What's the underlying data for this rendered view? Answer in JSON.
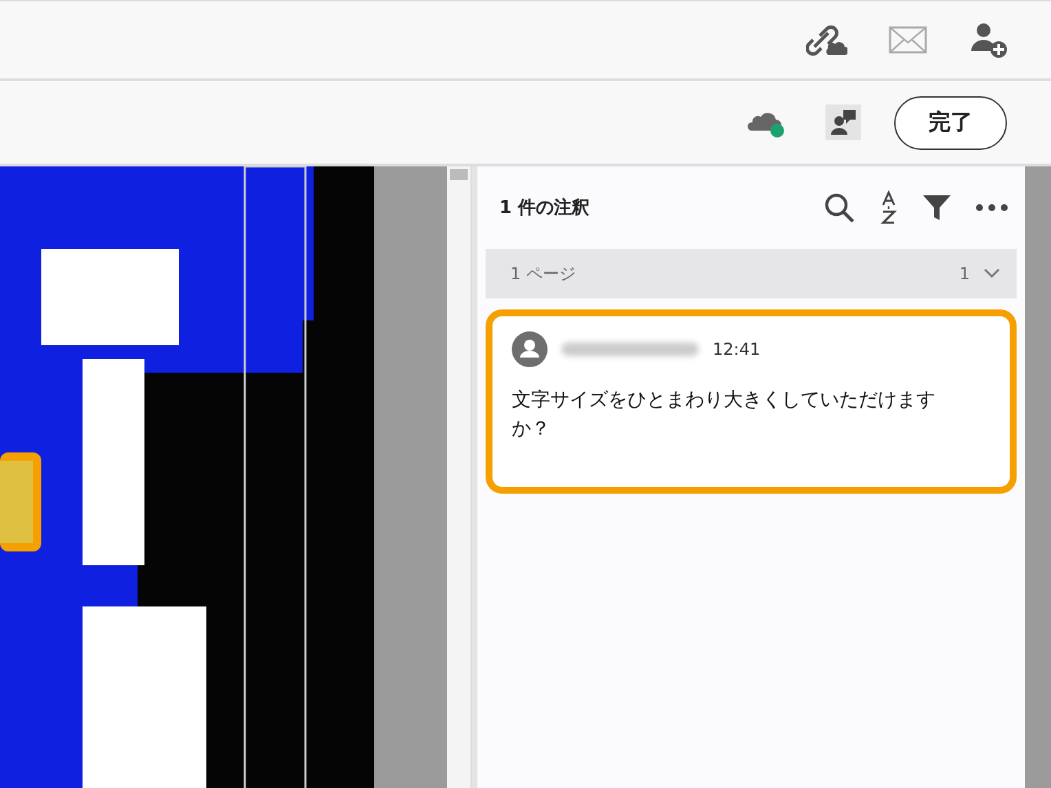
{
  "toolbar": {
    "done_button": "完了"
  },
  "comments_panel": {
    "title": "1 件の注釈",
    "page_group": {
      "label": "1 ページ",
      "count": "1",
      "expanded": true
    },
    "comments": [
      {
        "time": "12:41",
        "text": "文字サイズをひとまわり大きくしていただけますか？",
        "selected": true
      }
    ]
  }
}
